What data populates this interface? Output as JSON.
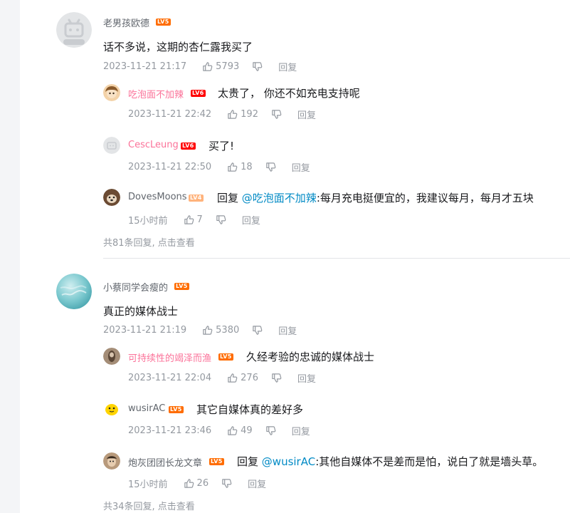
{
  "threads": [
    {
      "user": "老男孩欧德",
      "level": "LV5",
      "content": "话不多说，这期的杏仁露我买了",
      "time": "2023-11-21 21:17",
      "likes": "5793",
      "reply_label": "回复",
      "replies": [
        {
          "user": "吃泡面不加辣",
          "level": "LV6",
          "content": "太贵了， 你还不如充电支持呢",
          "time": "2023-11-21 22:42",
          "likes": "192",
          "reply_label": "回复"
        },
        {
          "user": "CescLeung",
          "level": "LV6",
          "content": "买了!",
          "time": "2023-11-21 22:50",
          "likes": "18",
          "reply_label": "回复"
        },
        {
          "user": "DovesMoons",
          "level": "LV4",
          "prefix": "回复",
          "mention": "@吃泡面不加辣",
          "content": ":每月充电挺便宜的，我建议每月，每月才五块",
          "time": "15小时前",
          "likes": "7",
          "reply_label": "回复"
        }
      ],
      "more_text": "共81条回复, 点击查看"
    },
    {
      "user": "小蔡同学会瘦的",
      "level": "LV5",
      "content": "真正的媒体战士",
      "time": "2023-11-21 21:19",
      "likes": "5380",
      "reply_label": "回复",
      "replies": [
        {
          "user": "可持续性的竭泽而渔",
          "level": "LV5",
          "content": "久经考验的忠诚的媒体战士",
          "time": "2023-11-21 22:04",
          "likes": "276",
          "reply_label": "回复"
        },
        {
          "user": "wusirAC",
          "level": "LV5",
          "content": "其它自媒体真的差好多",
          "time": "2023-11-21 23:46",
          "likes": "49",
          "reply_label": "回复"
        },
        {
          "user": "炮灰团团长龙文章",
          "level": "LV5",
          "prefix": "回复",
          "mention": "@wusirAC",
          "content": ":其他自媒体不是差而是怕，说白了就是墙头草。",
          "time": "15小时前",
          "likes": "26",
          "reply_label": "回复"
        }
      ],
      "more_text": "共34条回复, 点击查看"
    }
  ]
}
